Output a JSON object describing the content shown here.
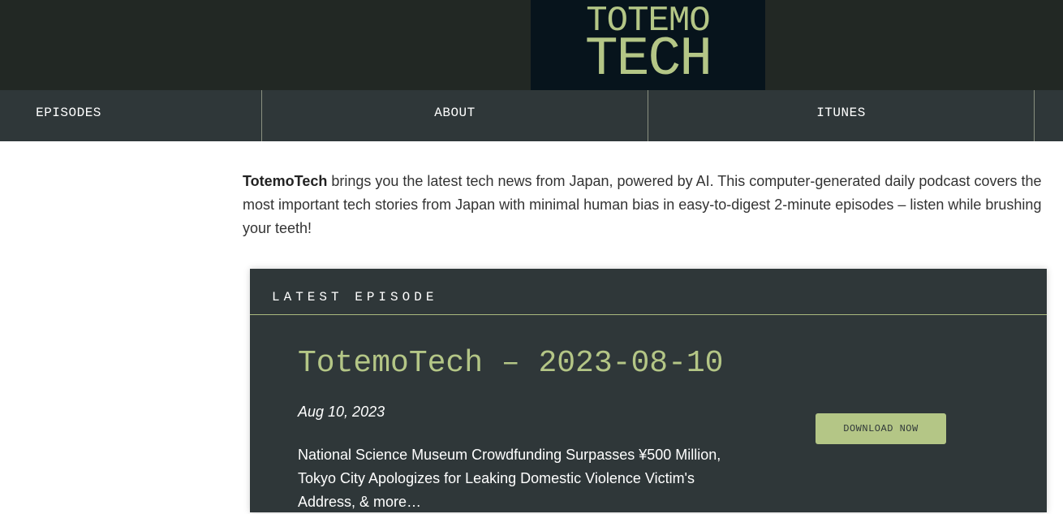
{
  "header": {
    "logo_line1": "TOTEMO",
    "logo_line2": "TECH"
  },
  "nav": {
    "items": [
      {
        "label": "EPISODES"
      },
      {
        "label": "ABOUT"
      },
      {
        "label": "ITUNES"
      }
    ]
  },
  "intro": {
    "brand": "TotemoTech",
    "text": " brings you the latest tech news from Japan, powered by AI. This computer-generated daily podcast covers the most important tech stories from Japan with minimal human bias in easy-to-digest 2-minute episodes – listen while brushing your teeth!"
  },
  "latest": {
    "label": "LATEST EPISODE",
    "title": "TotemoTech – 2023-08-10",
    "date": "Aug 10, 2023",
    "description": "National Science Museum Crowdfunding Surpasses ¥500 Million, Tokyo City Apologizes for Leaking Domestic Violence Victim's Address, & more…",
    "download_label": "DOWNLOAD NOW"
  },
  "colors": {
    "header_bg": "#222824",
    "logo_bg": "#07141c",
    "accent": "#b4c686",
    "nav_bg": "#2f3739",
    "card_bg": "#2f3739"
  }
}
